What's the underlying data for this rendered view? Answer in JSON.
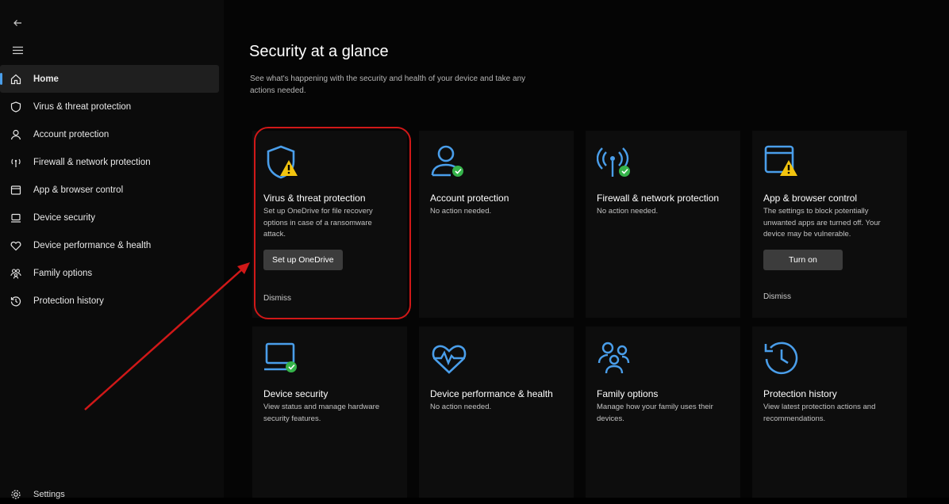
{
  "sidebar": {
    "items": [
      {
        "label": "Home",
        "icon": "home-icon",
        "active": true
      },
      {
        "label": "Virus & threat protection",
        "icon": "shield-icon"
      },
      {
        "label": "Account protection",
        "icon": "person-icon"
      },
      {
        "label": "Firewall & network protection",
        "icon": "wifi-antenna-icon"
      },
      {
        "label": "App & browser control",
        "icon": "browser-window-icon"
      },
      {
        "label": "Device security",
        "icon": "laptop-icon"
      },
      {
        "label": "Device performance & health",
        "icon": "heart-icon"
      },
      {
        "label": "Family options",
        "icon": "family-icon"
      },
      {
        "label": "Protection history",
        "icon": "history-icon"
      }
    ],
    "settings_label": "Settings"
  },
  "main": {
    "title": "Security at a glance",
    "subtitle": "See what's happening with the security and health of your device and take any actions needed.",
    "cards": [
      {
        "title": "Virus & threat protection",
        "desc": "Set up OneDrive for file recovery options in case of a ransomware attack.",
        "button": "Set up OneDrive",
        "dismiss": "Dismiss",
        "icon": "shield-icon",
        "status": "warning"
      },
      {
        "title": "Account protection",
        "desc": "No action needed.",
        "icon": "person-icon",
        "status": "ok"
      },
      {
        "title": "Firewall & network protection",
        "desc": "No action needed.",
        "icon": "wifi-antenna-icon",
        "status": "ok"
      },
      {
        "title": "App & browser control",
        "desc": "The settings to block potentially unwanted apps are turned off. Your device may be vulnerable.",
        "button": "Turn on",
        "dismiss": "Dismiss",
        "icon": "browser-window-icon",
        "status": "warning"
      },
      {
        "title": "Device security",
        "desc": "View status and manage hardware security features.",
        "icon": "laptop-icon",
        "status": "ok"
      },
      {
        "title": "Device performance & health",
        "desc": "No action needed.",
        "icon": "heart-icon",
        "status": "none"
      },
      {
        "title": "Family options",
        "desc": "Manage how your family uses their devices.",
        "icon": "family-icon",
        "status": "none"
      },
      {
        "title": "Protection history",
        "desc": "View latest protection actions and recommendations.",
        "icon": "history-icon",
        "status": "none"
      }
    ]
  },
  "colors": {
    "accent_blue": "#4a9eea",
    "ok_green": "#35b34a",
    "warning_yellow": "#f2c40f",
    "highlight_red": "#d01818"
  }
}
